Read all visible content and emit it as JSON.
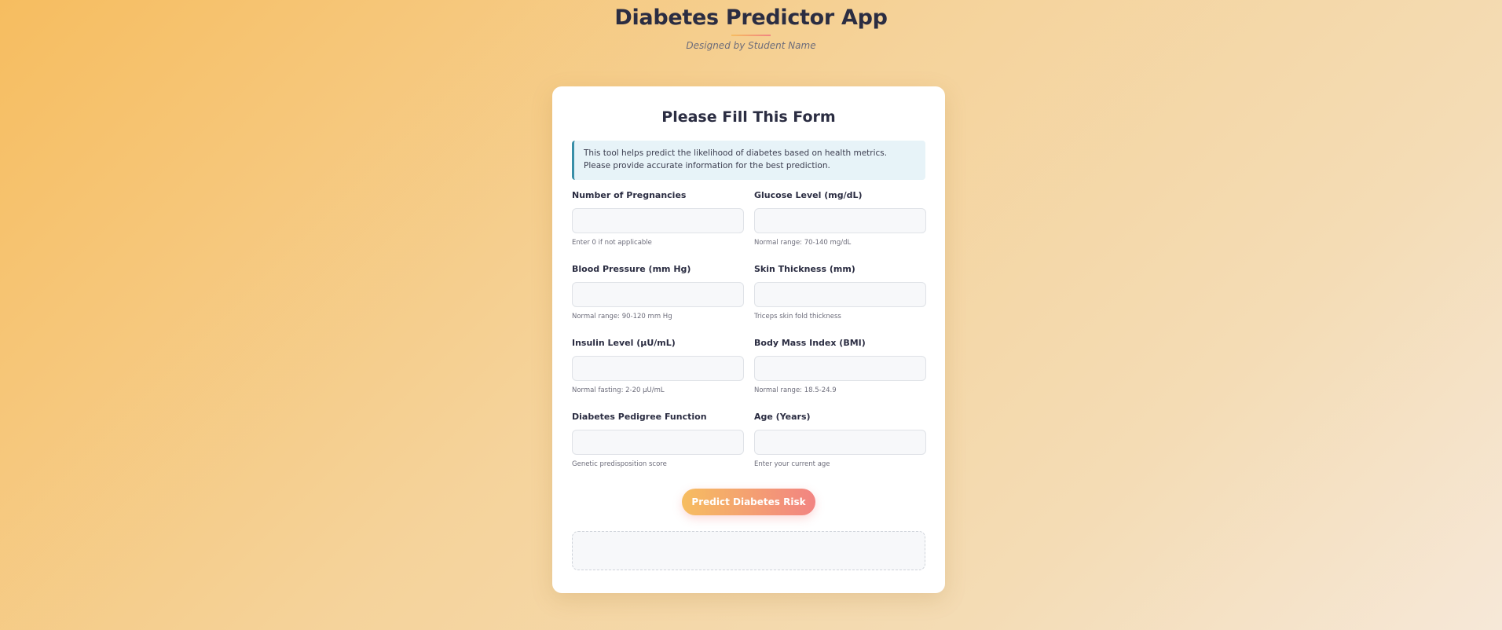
{
  "header": {
    "title": "Diabetes Predictor App",
    "subtitle": "Designed by Student Name"
  },
  "form": {
    "title": "Please Fill This Form",
    "info": "This tool helps predict the likelihood of diabetes based on health metrics. Please provide accurate information for the best prediction.",
    "fields": [
      {
        "label": "Number of Pregnancies",
        "value": "",
        "placeholder": "",
        "hint": "Enter 0 if not applicable"
      },
      {
        "label": "Glucose Level (mg/dL)",
        "value": "",
        "placeholder": "",
        "hint": "Normal range: 70-140 mg/dL"
      },
      {
        "label": "Blood Pressure (mm Hg)",
        "value": "",
        "placeholder": "",
        "hint": "Normal range: 90-120 mm Hg"
      },
      {
        "label": "Skin Thickness (mm)",
        "value": "",
        "placeholder": "",
        "hint": "Triceps skin fold thickness"
      },
      {
        "label": "Insulin Level (μU/mL)",
        "value": "",
        "placeholder": "",
        "hint": "Normal fasting: 2-20 μU/mL"
      },
      {
        "label": "Body Mass Index (BMI)",
        "value": "",
        "placeholder": "",
        "hint": "Normal range: 18.5-24.9"
      },
      {
        "label": "Diabetes Pedigree Function",
        "value": "",
        "placeholder": "",
        "hint": "Genetic predisposition score"
      },
      {
        "label": "Age (Years)",
        "value": "",
        "placeholder": "",
        "hint": "Enter your current age"
      }
    ],
    "submit_label": "Predict Diabetes Risk",
    "result": ""
  },
  "colors": {
    "accent_start": "#f6bd60",
    "accent_end": "#f28482",
    "info_border": "#3a8fa8",
    "text_dark": "#2b2d42"
  }
}
